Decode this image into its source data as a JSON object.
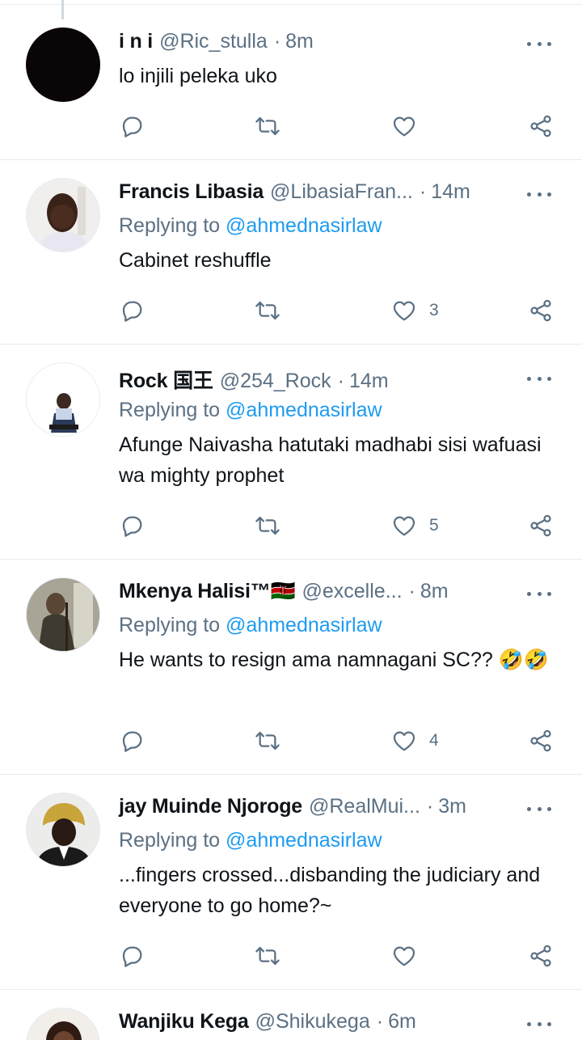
{
  "tweets": [
    {
      "name": "i n i",
      "handle": "@Ric_stulla",
      "time": "8m",
      "replying_prefix": "",
      "replying_to": "",
      "text": "lo injili peleka uko",
      "likes": "",
      "avatar": "black-circle"
    },
    {
      "name": "Francis Libasia",
      "handle": "@LibasiaFran...",
      "time": "14m",
      "replying_prefix": "Replying to ",
      "replying_to": "@ahmednasirlaw",
      "text": "Cabinet reshuffle",
      "likes": "3",
      "avatar": "portrait"
    },
    {
      "name": "Rock 国王",
      "handle": "@254_Rock",
      "time": "14m",
      "replying_prefix": "Replying to ",
      "replying_to": "@ahmednasirlaw",
      "text": "Afunge Naivasha hatutaki madhabi sisi wafuasi wa mighty prophet",
      "likes": "5",
      "avatar": "cartoon-figure"
    },
    {
      "name": "Mkenya Halisi™🇰🇪",
      "handle": "@excelle...",
      "time": "8m",
      "replying_prefix": "Replying to ",
      "replying_to": "@ahmednasirlaw",
      "text": "He wants to resign ama namnagani SC?? 🤣🤣",
      "likes": "4",
      "avatar": "robed-figure"
    },
    {
      "name": "jay Muinde Njoroge",
      "handle": "@RealMui...",
      "time": "3m",
      "replying_prefix": "Replying to ",
      "replying_to": "@ahmednasirlaw",
      "text": "...fingers crossed...disbanding the judiciary and everyone to go home?~",
      "likes": "",
      "avatar": "judge-wig"
    },
    {
      "name": "Wanjiku Kega",
      "handle": "@Shikukega",
      "time": "6m",
      "replying_prefix": "",
      "replying_to": "",
      "text": "",
      "likes": "",
      "avatar": "portrait-woman"
    }
  ],
  "icons": {
    "reply": "reply-icon",
    "retweet": "retweet-icon",
    "like": "heart-icon",
    "share": "share-icon",
    "more": "more-icon"
  },
  "colors": {
    "accent": "#1d9bf0",
    "muted": "#5b7083",
    "text": "#0f1419",
    "divider": "#e6ecf0"
  }
}
